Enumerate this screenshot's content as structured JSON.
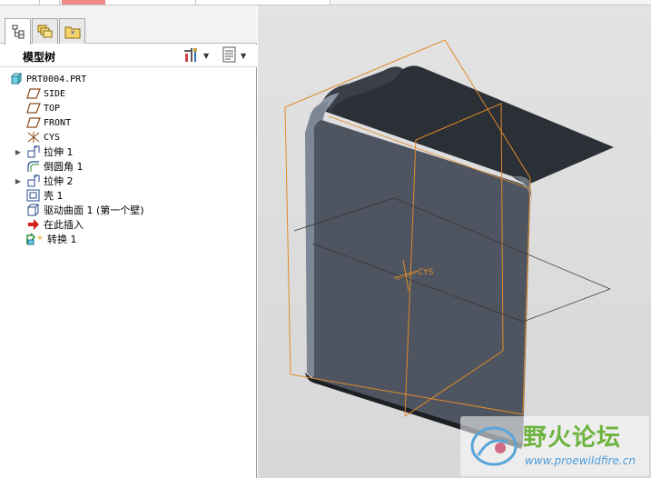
{
  "navigator": {
    "tabs": [
      {
        "name": "model-tree-tab",
        "icon": "model-tree-icon"
      },
      {
        "name": "folder-browser-tab",
        "icon": "folder-icon"
      },
      {
        "name": "favorites-tab",
        "icon": "favorites-icon"
      }
    ],
    "header": {
      "title": "模型树",
      "settings_icon": "tools-icon",
      "show_icon": "list-icon"
    }
  },
  "tree": {
    "items": [
      {
        "label": "PRT0004.PRT",
        "icon": "part-icon",
        "expandable": false
      },
      {
        "label": "SIDE",
        "icon": "datum-plane-icon",
        "expandable": false
      },
      {
        "label": "TOP",
        "icon": "datum-plane-icon",
        "expandable": false
      },
      {
        "label": "FRONT",
        "icon": "datum-plane-icon",
        "expandable": false
      },
      {
        "label": "CYS",
        "icon": "coordinate-system-icon",
        "expandable": false
      },
      {
        "label": "拉伸 1",
        "icon": "extrude-icon",
        "expandable": true
      },
      {
        "label": "倒圆角 1",
        "icon": "round-icon",
        "expandable": false
      },
      {
        "label": "拉伸 2",
        "icon": "extrude-icon",
        "expandable": true
      },
      {
        "label": "壳 1",
        "icon": "shell-icon",
        "expandable": false
      },
      {
        "label": "驱动曲面 1 (第一个壁)",
        "icon": "surface-icon",
        "expandable": false
      },
      {
        "label": "在此插入",
        "icon": "insert-arrow-icon",
        "expandable": false
      },
      {
        "label": "转换 1",
        "icon": "conversion-icon",
        "expandable": false
      }
    ]
  },
  "graphics": {
    "coordinate_label": "CYS",
    "model_color": "#4e5560",
    "datum_color": "#e08a2a"
  },
  "watermark": {
    "title": "野火论坛",
    "url": "www.proewildfire.cn"
  }
}
